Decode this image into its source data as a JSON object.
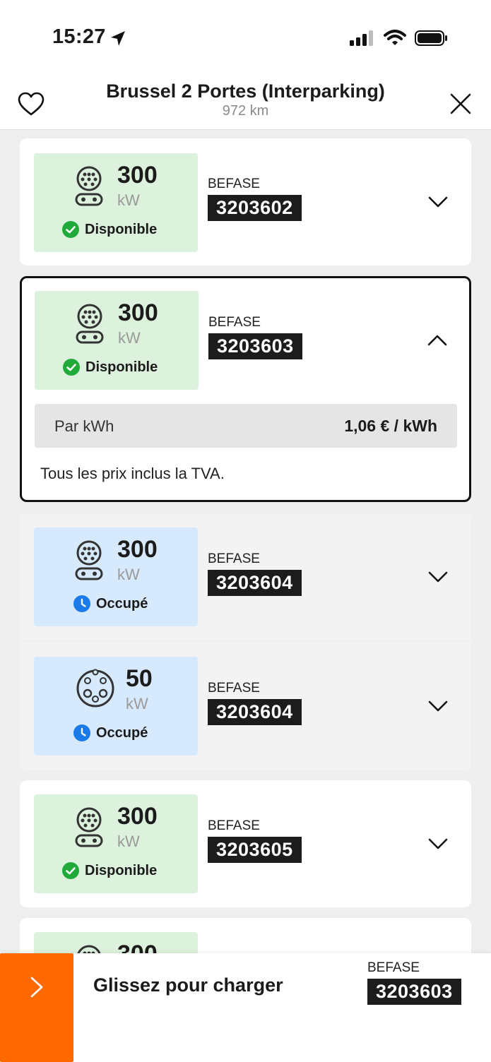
{
  "status_bar": {
    "time": "15:27"
  },
  "header": {
    "title": "Brussel 2 Portes (Interparking)",
    "distance": "972 km"
  },
  "connectors": [
    {
      "power": "300",
      "unit": "kW",
      "status": "Disponible",
      "status_color": "#1faa3a",
      "operator": "BEFASE",
      "evse_id": "3203602"
    },
    {
      "power": "300",
      "unit": "kW",
      "status": "Disponible",
      "status_color": "#1faa3a",
      "operator": "BEFASE",
      "evse_id": "3203603",
      "price_label": "Par kWh",
      "price_value": "1,06 € / kWh",
      "vat_note": "Tous les prix inclus la TVA."
    },
    {
      "power": "300",
      "unit": "kW",
      "status": "Occupé",
      "status_color": "#1a7ae8",
      "operator": "BEFASE",
      "evse_id": "3203604"
    },
    {
      "power": "50",
      "unit": "kW",
      "status": "Occupé",
      "status_color": "#1a7ae8",
      "operator": "BEFASE",
      "evse_id": "3203604"
    },
    {
      "power": "300",
      "unit": "kW",
      "status": "Disponible",
      "status_color": "#1faa3a",
      "operator": "BEFASE",
      "evse_id": "3203605"
    },
    {
      "power": "300"
    }
  ],
  "slider": {
    "label": "Glissez pour charger",
    "operator": "BEFASE",
    "evse_id": "3203603",
    "accent": "#ff6a00"
  }
}
